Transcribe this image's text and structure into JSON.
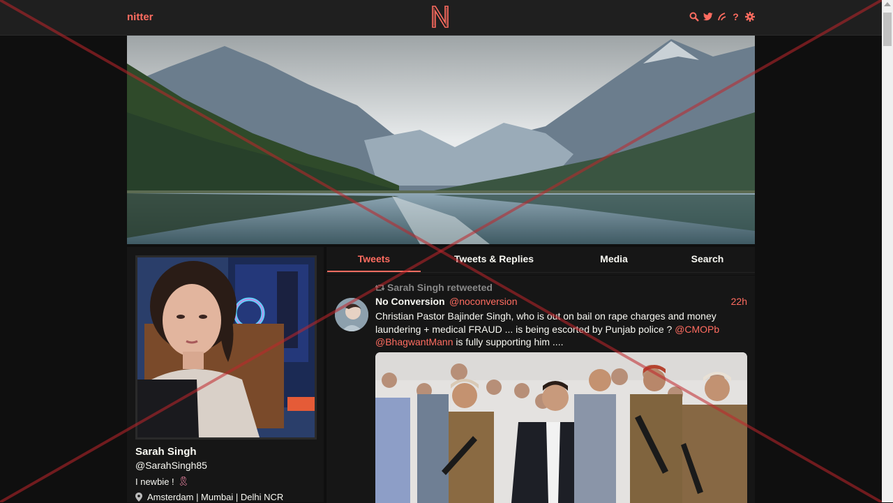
{
  "nav": {
    "brand": "nitter",
    "logo_letter": "N",
    "icons": [
      "search-icon",
      "twitter-bird-icon",
      "rss-icon",
      "question-icon",
      "gear-icon"
    ],
    "question_glyph": "?",
    "accent_color": "#ff6c60"
  },
  "profile": {
    "fullname": "Sarah Singh",
    "username": "@SarahSingh85",
    "bio": "I newbie !",
    "bio_icon": "ribbon-icon",
    "location": "Amsterdam | Mumbai | Delhi NCR"
  },
  "tabs": [
    {
      "label": "Tweets",
      "active": true
    },
    {
      "label": "Tweets & Replies",
      "active": false
    },
    {
      "label": "Media",
      "active": false
    },
    {
      "label": "Search",
      "active": false
    }
  ],
  "tweet": {
    "retweet_header": "Sarah Singh retweeted",
    "fullname": "No Conversion",
    "username": "@noconversion",
    "date": "22h",
    "text_part1": "Christian Pastor Bajinder Singh, who is out on bail on rape charges and money laundering  + medical FRAUD ... is being escorted by Punjab police ? ",
    "mention1": "@CMOPb",
    "mention2": "@BhagwantMann",
    "text_part2": "  is fully supporting him ...."
  }
}
